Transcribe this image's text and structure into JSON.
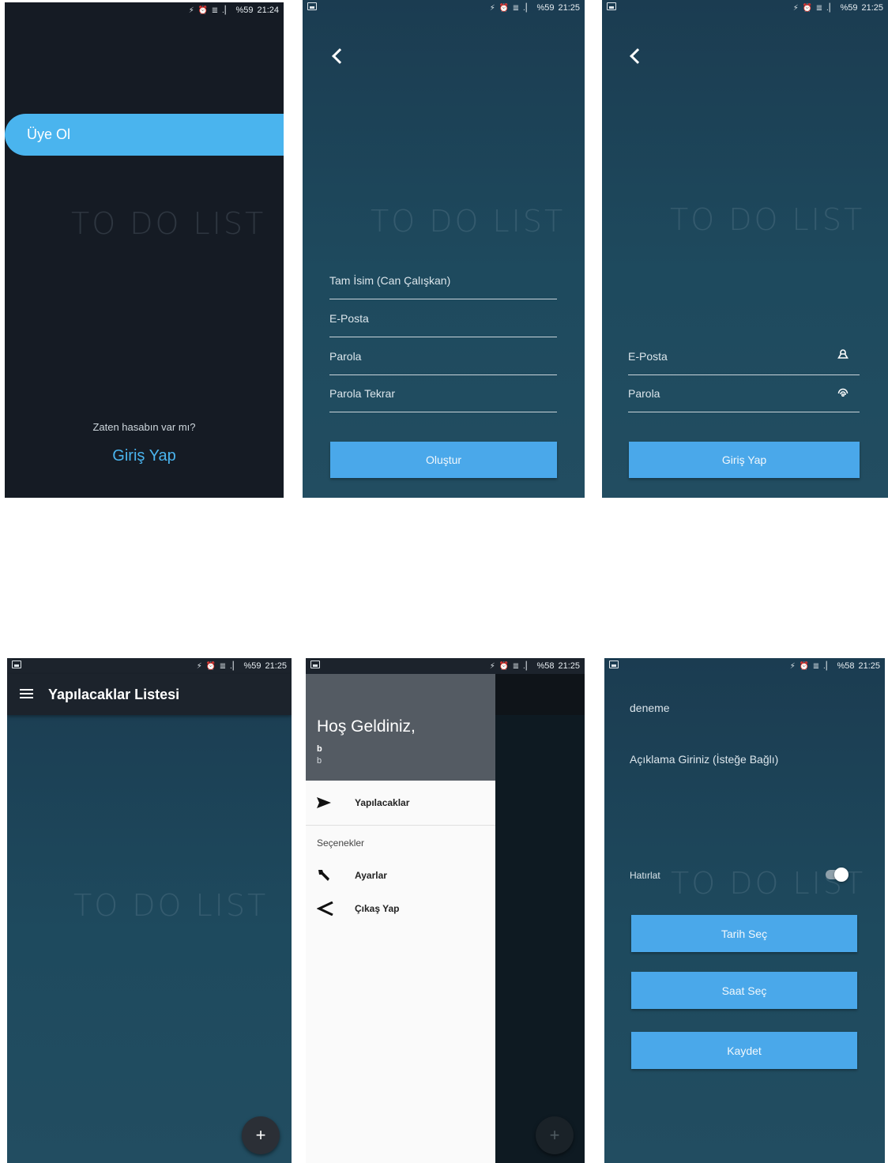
{
  "status_bars": [
    {
      "icons": "⚡ ⏰ ≣ .▏",
      "battery": "%59",
      "time": "21:24"
    },
    {
      "icons": "⚡ ⏰ ≣ .▏",
      "battery": "%59",
      "time": "21:25"
    },
    {
      "icons": "⚡ ⏰ ≣ .▏",
      "battery": "%59",
      "time": "21:25"
    },
    {
      "icons": "⚡ ⏰ ≣ .▏",
      "battery": "%59",
      "time": "21:25"
    },
    {
      "icons": "⚡ ⏰ ≣ .▏",
      "battery": "%58",
      "time": "21:25"
    },
    {
      "icons": "⚡ ⏰ ≣ .▏",
      "battery": "%58",
      "time": "21:25"
    }
  ],
  "watermark": "TO DO LIST",
  "welcome": {
    "register_button": "Üye Ol",
    "have_account": "Zaten hasabın var mı?",
    "login_link": "Giriş Yap"
  },
  "register": {
    "fullname_placeholder": "Tam İsim (Can Çalışkan)",
    "email_placeholder": "E-Posta",
    "password_placeholder": "Parola",
    "password_repeat_placeholder": "Parola Tekrar",
    "create_button": "Oluştur"
  },
  "login": {
    "email_placeholder": "E-Posta",
    "password_placeholder": "Parola",
    "login_button": "Giriş Yap"
  },
  "list": {
    "title": "Yapılacaklar Listesi",
    "fab": "+"
  },
  "drawer": {
    "greeting": "Hoş Geldiniz,",
    "user_name": "b",
    "user_email": "b",
    "todos_item": "Yapılacaklar",
    "section_label": "Seçenekler",
    "settings_item": "Ayarlar",
    "logout_item": "Çıkaş Yap",
    "fab": "+"
  },
  "add_task": {
    "title_value": "deneme",
    "description_placeholder": "Açıklama Giriniz (İsteğe Bağlı)",
    "remind_label": "Hatırlat",
    "remind_on": true,
    "date_button": "Tarih Seç",
    "time_button": "Saat Seç",
    "save_button": "Kaydet"
  },
  "colors": {
    "accent": "#4aa8ea",
    "dark_bg": "#151b24",
    "teal_bg": "#1e4a5e",
    "appbar": "#1c232c"
  }
}
